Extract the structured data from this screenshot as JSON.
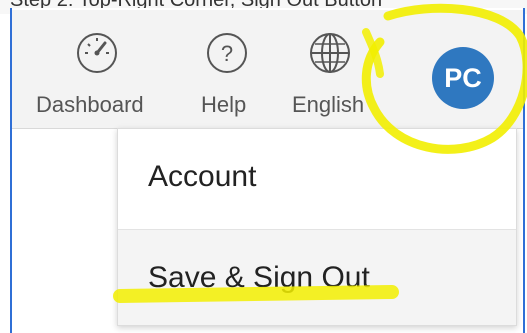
{
  "top_strip_text": "Step 2: Top-Right Corner, Sign Out Button",
  "toolbar": {
    "dashboard_label": "Dashboard",
    "help_label": "Help",
    "language_label": "English",
    "avatar_initials": "PC"
  },
  "menu": {
    "items": [
      {
        "label": "Account"
      },
      {
        "label": "Save & Sign Out"
      }
    ]
  },
  "colors": {
    "frame_border": "#2f6fd6",
    "avatar": "#2f78c0",
    "highlight": "#f2ee00"
  },
  "icons": [
    "dashboard-gauge-icon",
    "help-question-icon",
    "globe-icon"
  ]
}
